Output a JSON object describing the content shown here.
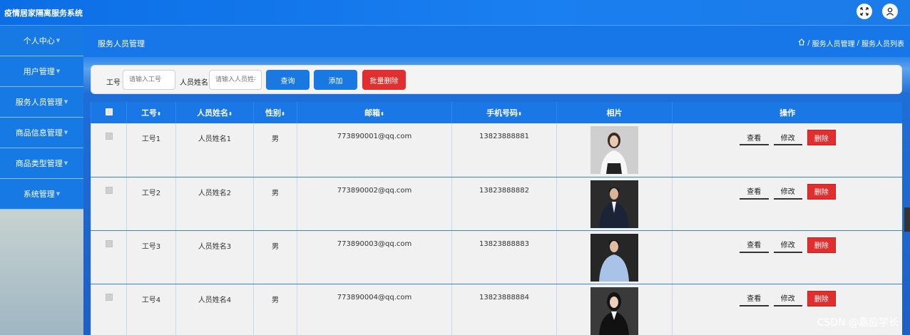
{
  "header": {
    "app_title": "疫情居家隔离服务系统",
    "icons": [
      "fullscreen-icon",
      "user-icon"
    ]
  },
  "sidebar": {
    "items": [
      {
        "label": "个人中心"
      },
      {
        "label": "用户管理"
      },
      {
        "label": "服务人员管理"
      },
      {
        "label": "商品信息管理"
      },
      {
        "label": "商品类型管理"
      },
      {
        "label": "系统管理"
      }
    ]
  },
  "page": {
    "title": "服务人员管理",
    "breadcrumb": [
      "服务人员管理",
      "服务人员列表"
    ]
  },
  "search": {
    "id_label": "工号",
    "id_placeholder": "请输入工号",
    "name_label": "人员姓名",
    "name_placeholder": "请输入人员姓名",
    "query_label": "查询",
    "add_label": "添加",
    "batch_delete_label": "批量删除"
  },
  "table": {
    "columns": [
      "工号",
      "人员姓名",
      "性别",
      "邮箱",
      "手机号码",
      "相片",
      "操作"
    ],
    "rows": [
      {
        "id": "工号1",
        "name": "人员姓名1",
        "gender": "男",
        "email": "773890001@qq.com",
        "phone": "13823888881"
      },
      {
        "id": "工号2",
        "name": "人员姓名2",
        "gender": "男",
        "email": "773890002@qq.com",
        "phone": "13823888882"
      },
      {
        "id": "工号3",
        "name": "人员姓名3",
        "gender": "男",
        "email": "773890003@qq.com",
        "phone": "13823888883"
      },
      {
        "id": "工号4",
        "name": "人员姓名4",
        "gender": "男",
        "email": "773890004@qq.com",
        "phone": "13823888884"
      }
    ],
    "actions": {
      "view": "查看",
      "edit": "修改",
      "delete": "删除"
    }
  },
  "watermark": "CSDN @嘉应学长",
  "colors": {
    "primary": "#1a77e6",
    "danger": "#e02f2f",
    "sidebar_bg": "#1679e4"
  }
}
